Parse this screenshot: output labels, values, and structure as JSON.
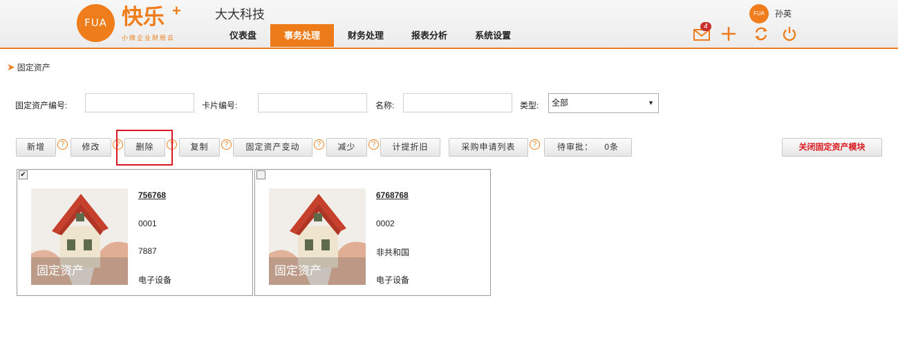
{
  "header": {
    "logo_text": "FUA",
    "brand_name": "快乐",
    "brand_plus": "+",
    "brand_sub": "小微企业财税云",
    "company": "大大科技",
    "nav": [
      {
        "label": "仪表盘",
        "active": false
      },
      {
        "label": "事务处理",
        "active": true
      },
      {
        "label": "财务处理",
        "active": false
      },
      {
        "label": "报表分析",
        "active": false
      },
      {
        "label": "系统设置",
        "active": false
      }
    ],
    "user_avatar_text": "FUA",
    "user_name": "孙英",
    "mail_count": "4",
    "icons": [
      "mail-icon",
      "add-icon",
      "refresh-icon",
      "power-icon"
    ],
    "accent_color": "#ee7b1a"
  },
  "breadcrumb": "固定资产",
  "filters": {
    "asset_no_label": "固定资产编号:",
    "asset_no_value": "",
    "card_no_label": "卡片编号:",
    "card_no_value": "",
    "name_label": "名称:",
    "name_value": "",
    "type_label": "类型:",
    "type_value": "全部"
  },
  "toolbar": {
    "add": "新增",
    "edit": "修改",
    "delete": "删除",
    "copy": "复制",
    "change": "固定资产变动",
    "reduce": "减少",
    "depreciation": "计提折旧",
    "purchase_list": "采购申请列表",
    "pending": "待审批：",
    "pending_count": "0条",
    "close_module": "关闭固定资产模块",
    "help_icon": "?"
  },
  "cards": [
    {
      "checked": true,
      "code": "756768",
      "card_no": "0001",
      "name": "7887",
      "type": "电子设备",
      "image_caption": "固定资产"
    },
    {
      "checked": false,
      "code": "6768768",
      "card_no": "0002",
      "name": "非共和国",
      "type": "电子设备",
      "image_caption": "固定资产"
    }
  ]
}
